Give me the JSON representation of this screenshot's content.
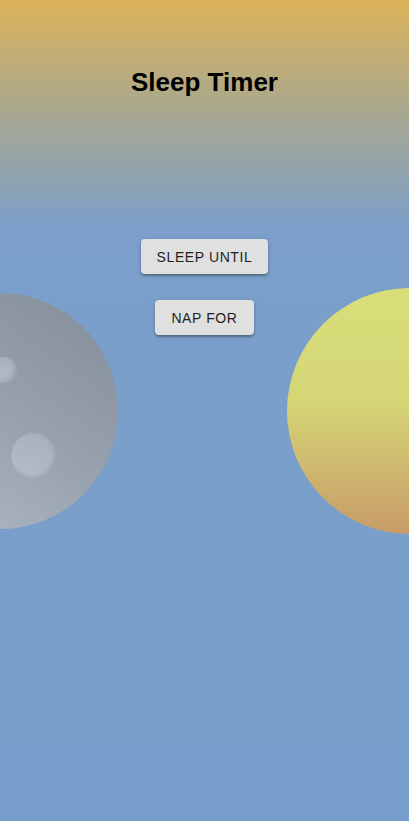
{
  "title": "Sleep Timer",
  "buttons": [
    {
      "label": "SLEEP UNTIL"
    },
    {
      "label": "NAP FOR"
    }
  ]
}
